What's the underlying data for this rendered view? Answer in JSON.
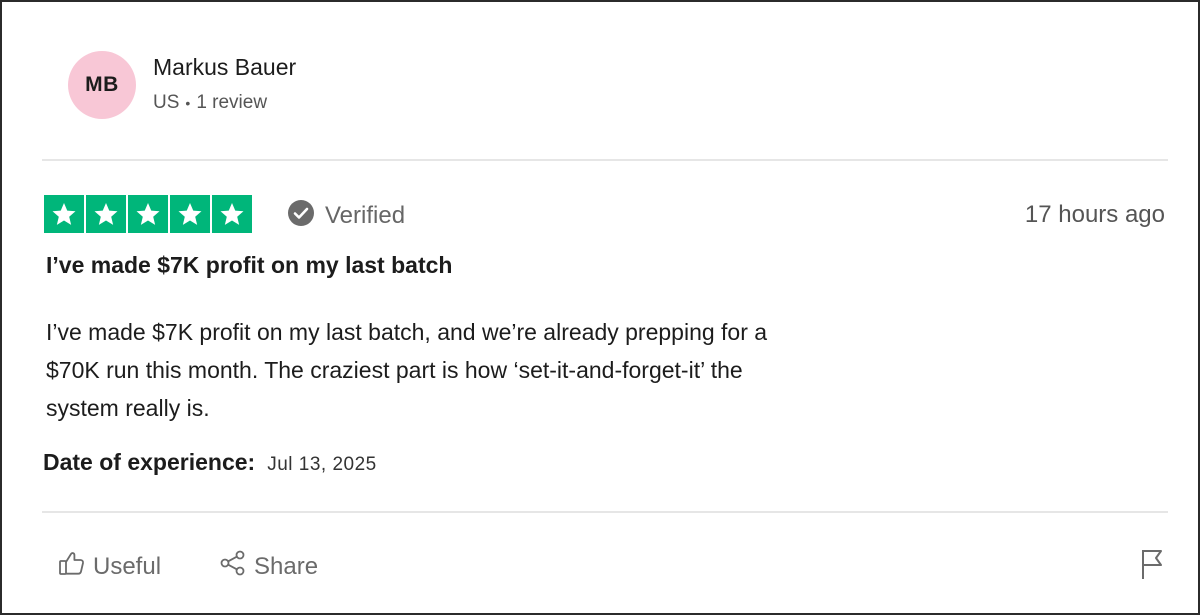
{
  "reviewer": {
    "initials": "MB",
    "name": "Markus Bauer",
    "country": "US",
    "separator": "•",
    "review_count": "1 review"
  },
  "review": {
    "rating": 5,
    "verified_label": "Verified",
    "time_ago": "17 hours ago",
    "title": "I’ve made $7K profit on my last batch",
    "body_lines": [
      "I’ve made $7K profit on my last batch, and we’re already prepping for a",
      "$70K run this month. The craziest part is how ‘set-it-and-forget-it’ the",
      "system really is."
    ],
    "experience_label": "Date of experience:",
    "experience_date": "Jul 13, 2025"
  },
  "actions": {
    "useful_label": "Useful",
    "share_label": "Share"
  },
  "icons": {
    "star": "star-icon",
    "verified": "check-circle-icon",
    "useful": "thumbs-up-icon",
    "share": "share-icon",
    "flag": "flag-icon"
  },
  "colors": {
    "star_green": "#00b67a",
    "avatar_pink": "#f8c7d6",
    "verified_gray": "#6b6b6b"
  }
}
